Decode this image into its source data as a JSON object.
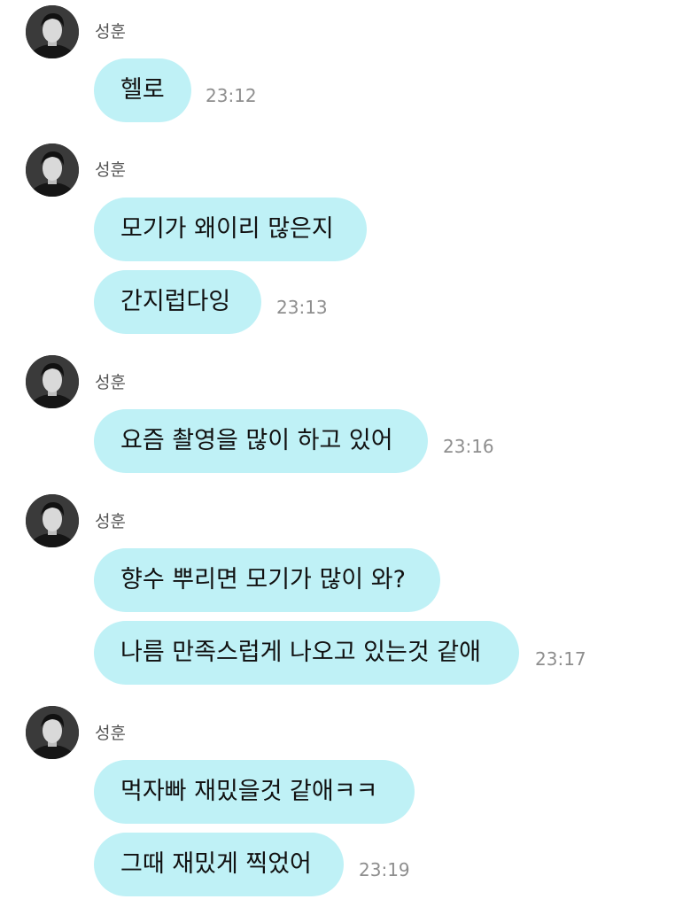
{
  "colors": {
    "bubble_bg": "#bff1f6",
    "timestamp": "#8e8e8e",
    "sender_name": "#555555"
  },
  "groups": [
    {
      "sender": "성훈",
      "messages": [
        {
          "text": "헬로",
          "time": "23:12"
        }
      ]
    },
    {
      "sender": "성훈",
      "messages": [
        {
          "text": "모기가 왜이리 많은지",
          "time": ""
        },
        {
          "text": "간지럽다잉",
          "time": "23:13"
        }
      ]
    },
    {
      "sender": "성훈",
      "messages": [
        {
          "text": "요즘 촬영을 많이 하고 있어",
          "time": "23:16"
        }
      ]
    },
    {
      "sender": "성훈",
      "messages": [
        {
          "text": "향수 뿌리면 모기가 많이 와?",
          "time": ""
        },
        {
          "text": "나름 만족스럽게 나오고 있는것 같애",
          "time": "23:17"
        }
      ]
    },
    {
      "sender": "성훈",
      "messages": [
        {
          "text": "먹자빠 재밌을것 같애ㅋㅋ",
          "time": ""
        },
        {
          "text": "그때 재밌게 찍었어",
          "time": "23:19"
        }
      ]
    }
  ]
}
